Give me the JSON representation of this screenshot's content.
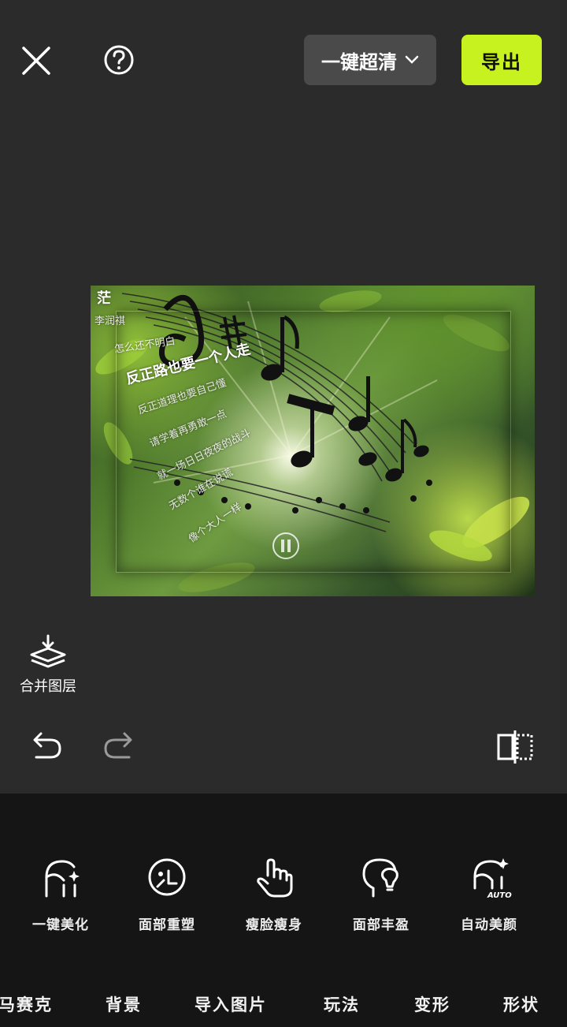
{
  "topbar": {
    "close_icon": "close-icon",
    "help_icon": "help-icon",
    "hd_label": "一键超清",
    "export_label": "导出"
  },
  "canvas": {
    "lyrics": [
      "茫",
      "李润祺",
      "怎么还不明白",
      "反正路也要一个人走",
      "反正道理也要自己懂",
      "请学着再勇敢一点",
      "就一场日日夜夜的战斗",
      "无数个谁在说谎",
      "像个大人一样"
    ]
  },
  "merge": {
    "label": "合并图层",
    "icon": "layers-merge-icon"
  },
  "history": {
    "undo_icon": "undo-icon",
    "redo_icon": "redo-icon",
    "compare_icon": "compare-icon"
  },
  "tools": [
    {
      "label": "一键美化",
      "icon": "face-sparkle-icon"
    },
    {
      "label": "面部重塑",
      "icon": "face-reshape-icon"
    },
    {
      "label": "瘦脸瘦身",
      "icon": "hand-tap-icon"
    },
    {
      "label": "面部丰盈",
      "icon": "face-fill-icon"
    },
    {
      "label": "自动美颜",
      "icon": "auto-beauty-icon"
    }
  ],
  "tabs": [
    "马赛克",
    "背景",
    "导入图片",
    "玩法",
    "变形",
    "形状"
  ],
  "colors": {
    "accent": "#c7f21f",
    "background": "#2b2b2b",
    "panel": "#151515"
  }
}
